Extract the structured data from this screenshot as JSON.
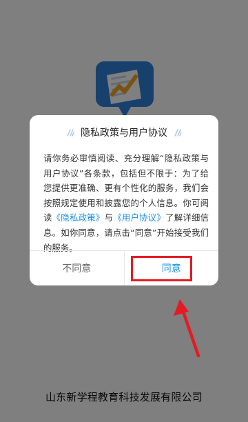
{
  "company": {
    "name": "山东新学程教育科技发展有限公司"
  },
  "dialog": {
    "title": "隐私政策与用户协议",
    "body_part1": "请你务必审慎阅读、充分理解“隐私政策与用户协议”各条款，包括但不限于：为了给您提供更准确、更有个性化的服务，我们会按照规定使用和披露您的个人信息。你可阅读",
    "privacy_link": "《隐私政策》",
    "body_part2": "与",
    "user_agreement_link": "《用户协议》",
    "body_part3": "了解详细信息。如你同意，请点击“同意”开始接受我们的服务。",
    "disagree_label": "不同意",
    "agree_label": "同意"
  },
  "colors": {
    "link_blue": "#1a8fe8",
    "annotation_red": "#e31b23",
    "logo_blue": "#2f80d8"
  },
  "icons": {
    "app_logo": "document-chart-app-icon",
    "title_decoration": "sparkle-icon",
    "annotation": "red-arrow-icon"
  }
}
